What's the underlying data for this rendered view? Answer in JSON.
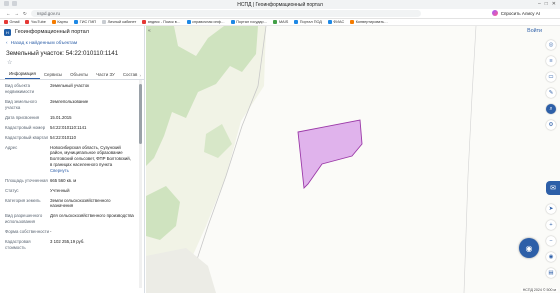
{
  "browser": {
    "window_title": "НСПД | Геоинформационный портал",
    "url": "nspd.gov.ru",
    "assistant_label": "Спросить Алису AI",
    "bookmarks": [
      "Gmail",
      "YouTube",
      "Карты",
      "ГИС ГМП",
      "Личный кабинет",
      "яндекс - Поиск в…",
      "справочная инф…",
      "Портал государ…",
      "MAIS",
      "Портал ПОД",
      "ФИАС",
      "Конвертировать…"
    ]
  },
  "panel": {
    "app_name": "Геоинформационный портал",
    "back_label": "Назад к найденным объектам",
    "object_title": "Земельный участок: 54:22:010110:1141",
    "tabs": [
      "Информация",
      "Сервисы",
      "Объекты",
      "Части ЗУ",
      "Состав"
    ],
    "tab_more": "›",
    "show_more_link": "Свернуть",
    "fields": [
      {
        "key": "Вид объекта недвижимости",
        "value": "Земельный участок"
      },
      {
        "key": "Вид земельного участка",
        "value": "Землепользование"
      },
      {
        "key": "Дата присвоения",
        "value": "15.01.2015"
      },
      {
        "key": "Кадастровый номер",
        "value": "54:22:010110:1141"
      },
      {
        "key": "Кадастровый квартал",
        "value": "54:22:010110"
      },
      {
        "key": "Адрес",
        "value": "Новосибирская область, Сузунский район, муниципальное образование Болтовский сельсовет, ФПР Болтовский, в границах населенного пункта"
      },
      {
        "key": "Площадь уточненная",
        "value": "665 560 кв. м"
      },
      {
        "key": "Статус",
        "value": "Учтенный"
      },
      {
        "key": "Категория земель",
        "value": "Земли сельскохозяйственного назначения"
      },
      {
        "key": "Вид разрешенного использования",
        "value": "Для сельскохозяйственного производства"
      },
      {
        "key": "Форма собственности",
        "value": "-"
      },
      {
        "key": "Кадастровая стоимость",
        "value": "3 102 255,19 руб."
      }
    ]
  },
  "map": {
    "login_label": "Войти",
    "attribution": "НСПД 2024 ©  500 м",
    "colors": {
      "forest": "#cfe3bf",
      "field": "#f0f2e4",
      "parcel_fill": "#d79be8",
      "parcel_stroke": "#9b3aa8",
      "accent": "#2d5fa8"
    }
  }
}
